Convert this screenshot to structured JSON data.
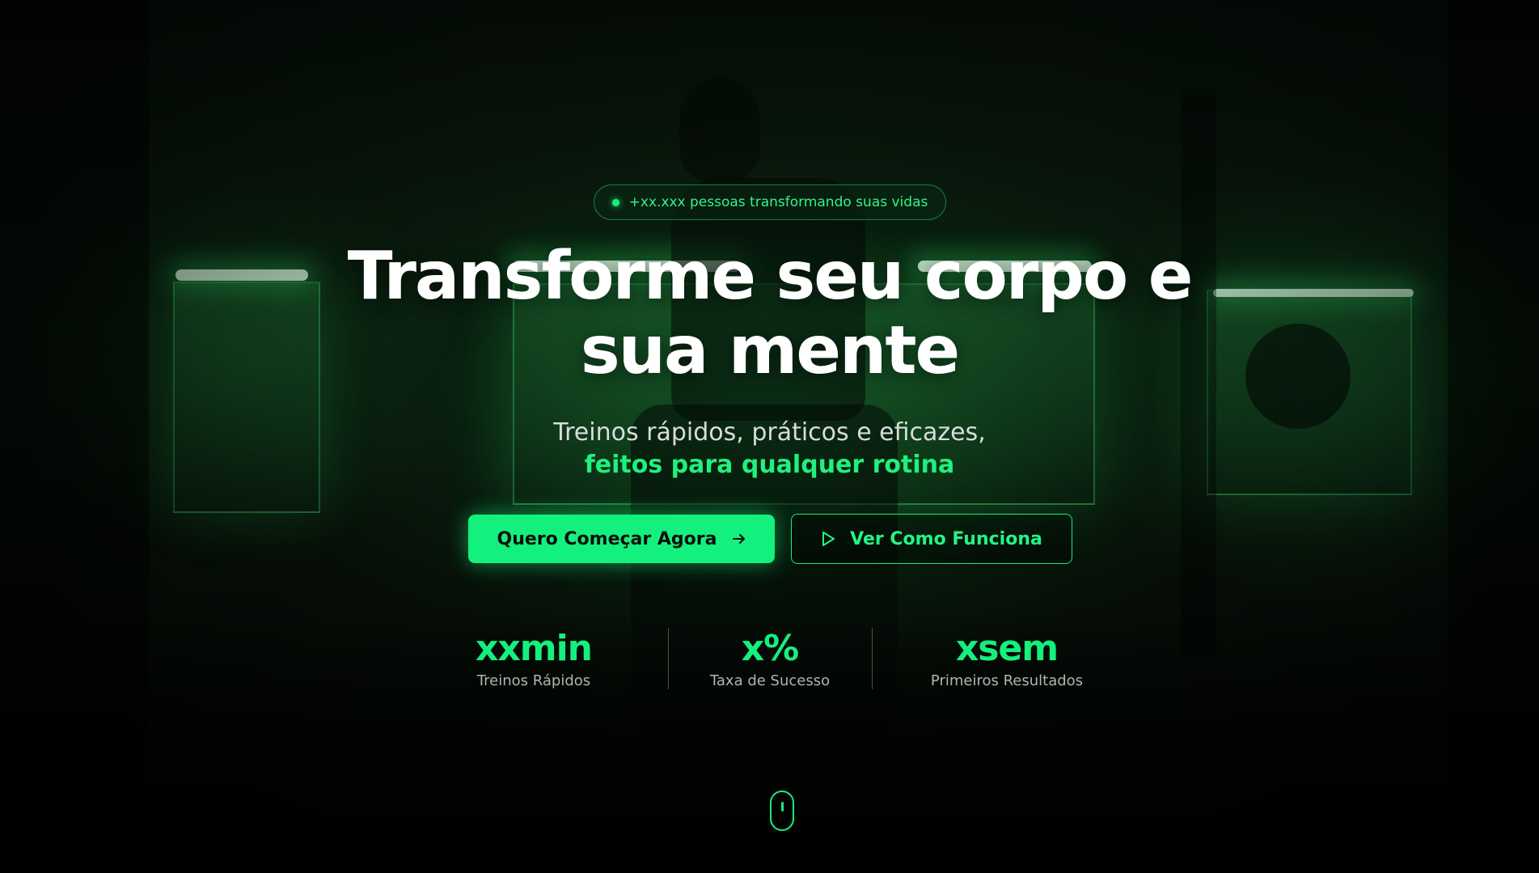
{
  "hero": {
    "badge_text": "+xx.xxx pessoas transformando suas vidas",
    "headline_line1": "Transforme seu corpo e",
    "headline_line2": "sua mente",
    "subtitle_line1": "Treinos rápidos, práticos e eficazes,",
    "subtitle_line2": "feitos para qualquer rotina"
  },
  "buttons": {
    "primary_label": "Quero Começar Agora",
    "primary_icon": "arrow-right-icon",
    "secondary_label": "Ver Como Funciona",
    "secondary_icon": "play-icon"
  },
  "stats": [
    {
      "value": "xxmin",
      "label": "Treinos Rápidos"
    },
    {
      "value": "x%",
      "label": "Taxa de Sucesso"
    },
    {
      "value": "xsem",
      "label": "Primeiros Resultados"
    }
  ],
  "scroll_indicator": {
    "icon": "mouse-scroll-icon"
  },
  "colors": {
    "accent": "#14f07d",
    "background": "#040604",
    "headline": "#ffffff",
    "subtitle": "#d8dcd9",
    "stat_label": "#aeb6b0"
  }
}
